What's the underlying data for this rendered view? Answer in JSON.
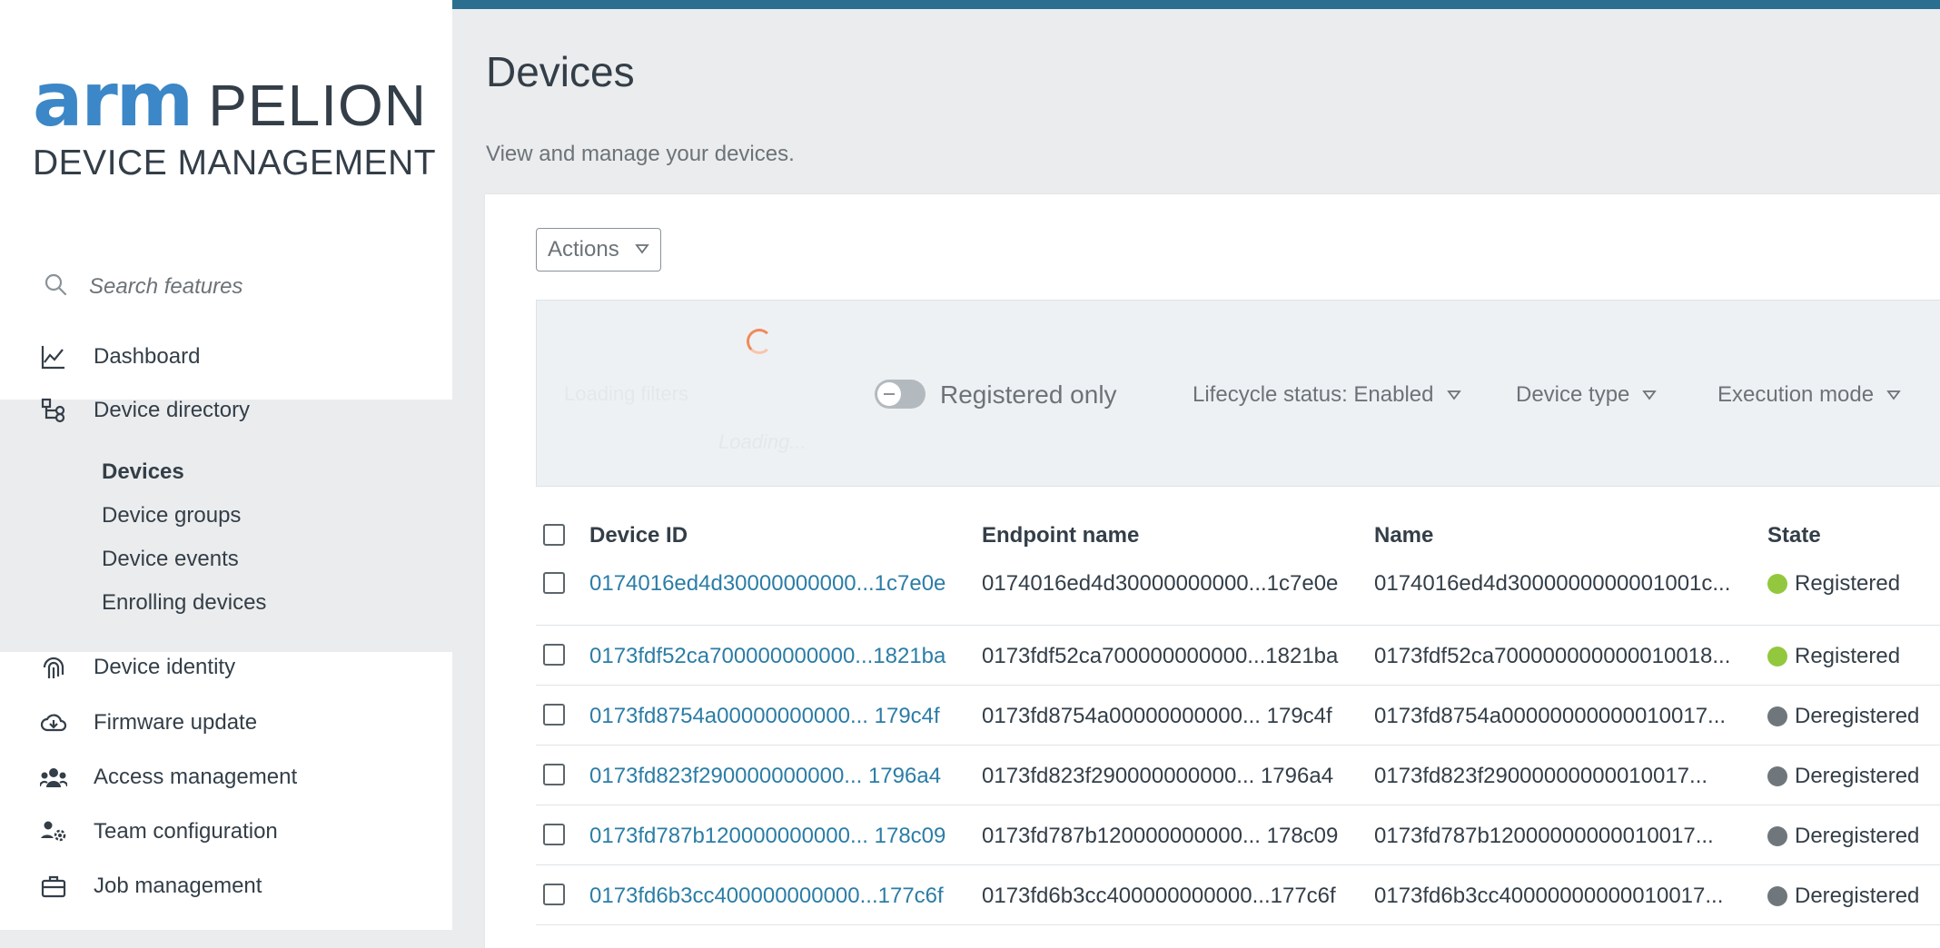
{
  "brand": {
    "logo_arm": "arm",
    "logo_pelion": "PELION",
    "logo_sub": "DEVICE MANAGEMENT"
  },
  "sidebar": {
    "search_placeholder": "Search features",
    "items": [
      {
        "label": "Dashboard",
        "icon": "chart-line-icon"
      },
      {
        "label": "Device directory",
        "icon": "hierarchy-icon"
      },
      {
        "label": "Device identity",
        "icon": "fingerprint-icon"
      },
      {
        "label": "Firmware update",
        "icon": "cloud-download-icon"
      },
      {
        "label": "Access management",
        "icon": "users-icon"
      },
      {
        "label": "Team configuration",
        "icon": "team-settings-icon"
      },
      {
        "label": "Job management",
        "icon": "briefcase-icon"
      }
    ],
    "sub_items": [
      "Devices",
      "Device groups",
      "Device events",
      "Enrolling devices"
    ]
  },
  "page": {
    "title": "Devices",
    "subtitle": "View and manage your devices."
  },
  "toolbar": {
    "actions_label": "Actions"
  },
  "filters": {
    "ghost_loading_filters": "Loading filters",
    "ghost_loading": "Loading...",
    "registered_only": "Registered only",
    "lifecycle": "Lifecycle status: Enabled",
    "device_type": "Device type",
    "execution_mode": "Execution mode"
  },
  "table": {
    "headers": [
      "Device ID",
      "Endpoint name",
      "Name",
      "State"
    ],
    "rows": [
      {
        "id": "0174016ed4d30000000000...1c7e0e",
        "endpoint": "0174016ed4d30000000000...1c7e0e",
        "name": "0174016ed4d3000000000001001c...",
        "state": "Registered"
      },
      {
        "id": "0173fdf52ca700000000000...1821ba",
        "endpoint": "0173fdf52ca700000000000...1821ba",
        "name": "0173fdf52ca700000000000010018...",
        "state": "Registered"
      },
      {
        "id": "0173fd8754a00000000000... 179c4f",
        "endpoint": "0173fd8754a00000000000... 179c4f",
        "name": "0173fd8754a00000000000010017...",
        "state": "Deregistered"
      },
      {
        "id": "0173fd823f290000000000... 1796a4",
        "endpoint": "0173fd823f290000000000... 1796a4",
        "name": "0173fd823f29000000000010017...",
        "state": "Deregistered"
      },
      {
        "id": "0173fd787b120000000000... 178c09",
        "endpoint": "0173fd787b120000000000... 178c09",
        "name": "0173fd787b12000000000010017...",
        "state": "Deregistered"
      },
      {
        "id": "0173fd6b3cc400000000000...177c6f",
        "endpoint": "0173fd6b3cc400000000000...177c6f",
        "name": "0173fd6b3cc40000000000010017...",
        "state": "Deregistered"
      }
    ]
  },
  "colors": {
    "brand_blue": "#3b87c7",
    "topbar": "#2b6f90",
    "link": "#2b7da6",
    "registered": "#93c83e",
    "deregistered": "#6f777c"
  }
}
